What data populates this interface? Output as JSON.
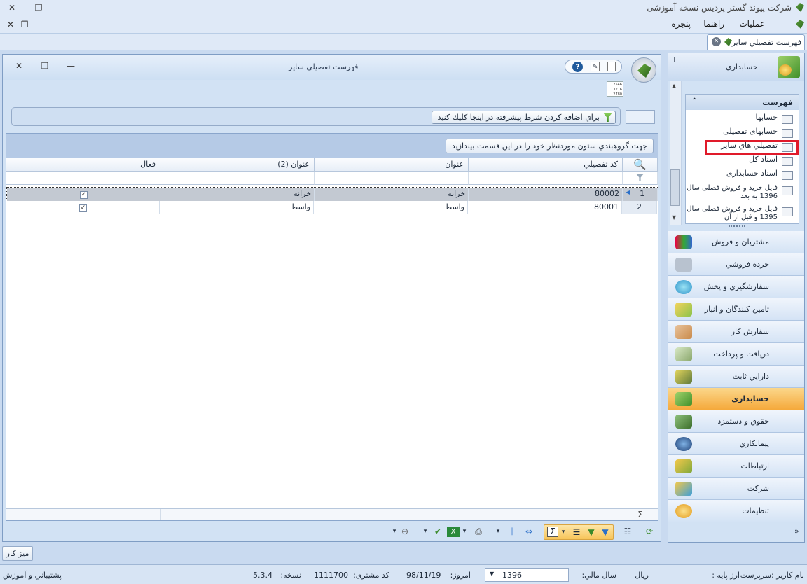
{
  "app": {
    "title": "شرکت پیوند گستر پردیس نسخه آموزشی"
  },
  "menu": [
    "عملیات",
    "راهنما",
    "پنجره"
  ],
  "doc_tab": {
    "label": "فهرست تفصيلي سایر"
  },
  "inner_window": {
    "caption": "فهرست تفصيلي سایر",
    "filter_label": "براي اضافه كردن شرط پيشرفته در اينجا كليك كنيد",
    "group_hint": "جهت گروهبندي ستون موردنظر خود را در اين قسمت بيندازيد"
  },
  "grid": {
    "columns": [
      "كد تفصيلي",
      "عنوان",
      "عنوان (2)",
      "فعال"
    ],
    "rows": [
      {
        "num": "1",
        "code": "80002",
        "title": "خزانه",
        "title2": "خزانه",
        "active": "✓"
      },
      {
        "num": "2",
        "code": "80001",
        "title": "واسط",
        "title2": "واسط",
        "active": "✓"
      }
    ],
    "footer_symbol": "Σ"
  },
  "nav": {
    "header": "حسابداري",
    "list_title": "فهرست",
    "items": [
      "حسابها",
      "حسابهای تفصیلی",
      "تفصيلي هاي ساير",
      "اسناد کل",
      "اسناد حسابداری",
      "فایل خرید و فروش فصلی سال 1396 به بعد",
      "فایل خرید و فروش فصلی سال 1395 و قبل از آن"
    ],
    "modules": [
      "مشتريان و فروش",
      "خرده فروشي",
      "سفارشگيري و پخش",
      "تامين كنندگان و انبار",
      "سفارش كار",
      "دريافت و پرداخت",
      "دارايي ثابت",
      "حسابداري",
      "حقوق و دستمزد",
      "پيمانكاري",
      "ارتباطات",
      "شركت",
      "تنظيمات"
    ]
  },
  "desk_button": "ميز كار",
  "status": {
    "username_label": "نام کاربر :سرپرست",
    "currency_label": "ارز پایه :",
    "currency_value": "ريال",
    "fiscal_label": "سال مالي:",
    "fiscal_value": "1396",
    "today_label": "امروز:",
    "today_value": "98/11/19",
    "customer_label": "کد مشتری:",
    "customer_value": "1111700",
    "version_label": "نسخه:",
    "version_value": "5.3.4",
    "support": "پشتيباني و آموزش"
  }
}
